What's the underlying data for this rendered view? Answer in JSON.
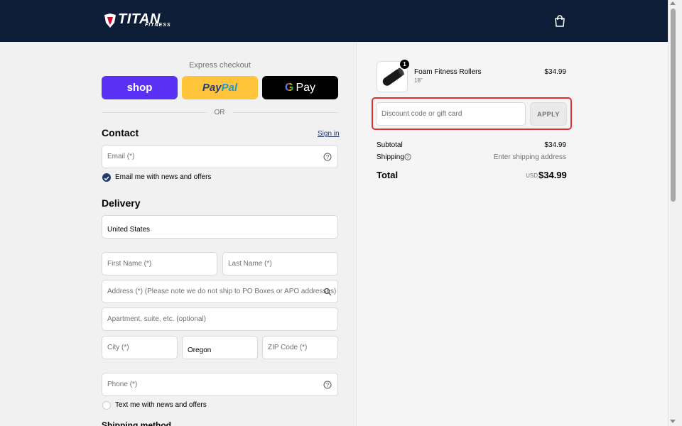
{
  "brand": {
    "name": "TITAN",
    "sub": "FITNESS"
  },
  "express": {
    "label": "Express checkout",
    "shop": "shop",
    "paypal": "PayPal",
    "gpay": "Pay",
    "or": "OR"
  },
  "contact": {
    "title": "Contact",
    "sign_in": "Sign in",
    "email_placeholder": "Email (*)",
    "newsletter": "Email me with news and offers"
  },
  "delivery": {
    "title": "Delivery",
    "country": "United States",
    "first_name": "First Name (*)",
    "last_name": "Last Name (*)",
    "address": "Address (*) (Please note we do not ship to PO Boxes or APO addresses)",
    "apartment": "Apartment, suite, etc. (optional)",
    "city": "City (*)",
    "state": "Oregon",
    "zip": "ZIP Code (*)",
    "phone": "Phone (*)",
    "text_offers": "Text me with news and offers",
    "shipping_method": "Shipping method"
  },
  "cart": {
    "product_name": "Foam Fitness Rollers",
    "variant": "18\"",
    "price": "$34.99",
    "quantity": "1",
    "discount_placeholder": "Discount code or gift card",
    "apply": "APPLY",
    "subtotal_label": "Subtotal",
    "subtotal": "$34.99",
    "shipping_label": "Shipping",
    "shipping_value": "Enter shipping address",
    "total_label": "Total",
    "currency": "USD",
    "total": "$34.99"
  },
  "colors": {
    "header": "#0d1d37",
    "accent": "#1f3a68",
    "highlight": "#e02d2d",
    "shop": "#5a31f4",
    "paypal": "#ffc439"
  }
}
